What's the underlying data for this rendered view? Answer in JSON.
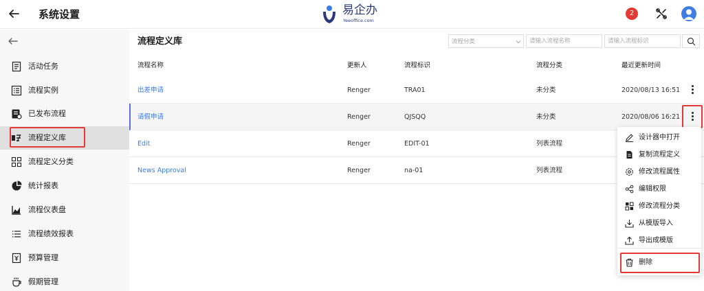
{
  "header": {
    "title": "系统设置",
    "logo_cn": "易企办",
    "logo_en": "Yeeoffice.com",
    "notifications": "2"
  },
  "sidebar": {
    "items": [
      {
        "label": "活动任务",
        "icon": "task-list-icon"
      },
      {
        "label": "流程实例",
        "icon": "instance-list-icon"
      },
      {
        "label": "已发布流程",
        "icon": "published-icon"
      },
      {
        "label": "流程定义库",
        "icon": "definition-library-icon",
        "active": true
      },
      {
        "label": "流程定义分类",
        "icon": "category-grid-icon"
      },
      {
        "label": "统计报表",
        "icon": "pie-chart-icon"
      },
      {
        "label": "流程仪表盘",
        "icon": "line-chart-icon"
      },
      {
        "label": "流程绩效报表",
        "icon": "bullet-list-icon"
      },
      {
        "label": "预算管理",
        "icon": "budget-icon"
      },
      {
        "label": "假期管理",
        "icon": "cup-icon"
      }
    ]
  },
  "main": {
    "title": "流程定义库",
    "filters": {
      "category_placeholder": "流程分类",
      "name_placeholder": "请输入流程名称",
      "id_placeholder": "请输入流程标识"
    },
    "columns": [
      "流程名称",
      "更新人",
      "流程标识",
      "流程分类",
      "最近更新时间"
    ],
    "rows": [
      {
        "name": "出差申请",
        "updater": "Renger",
        "key": "TRA01",
        "category": "未分类",
        "updated": "2020/08/13 16:51"
      },
      {
        "name": "请假申请",
        "updater": "Renger",
        "key": "QJSQQ",
        "category": "未分类",
        "updated": "2020/08/06 16:21"
      },
      {
        "name": "Edit",
        "updater": "Renger",
        "key": "EDIT-01",
        "category": "列表流程",
        "updated": ""
      },
      {
        "name": "News Approval",
        "updater": "Renger",
        "key": "na-01",
        "category": "列表流程",
        "updated": ""
      }
    ]
  },
  "context_menu": {
    "items": [
      {
        "label": "设计器中打开",
        "icon": "pencil-icon"
      },
      {
        "label": "复制流程定义",
        "icon": "copy-doc-icon"
      },
      {
        "label": "修改流程属性",
        "icon": "gear-icon"
      },
      {
        "label": "编辑权限",
        "icon": "share-icon"
      },
      {
        "label": "修改流程分类",
        "icon": "category-grid-icon"
      },
      {
        "label": "从模版导入",
        "icon": "download-icon"
      },
      {
        "label": "导出成模版",
        "icon": "upload-icon"
      },
      {
        "label": "删除",
        "icon": "trash-icon"
      }
    ]
  },
  "colors": {
    "accent": "#3d7de4",
    "highlight": "#e53935",
    "badge": "#e53935",
    "selected_row_border": "#5b6fd6"
  }
}
